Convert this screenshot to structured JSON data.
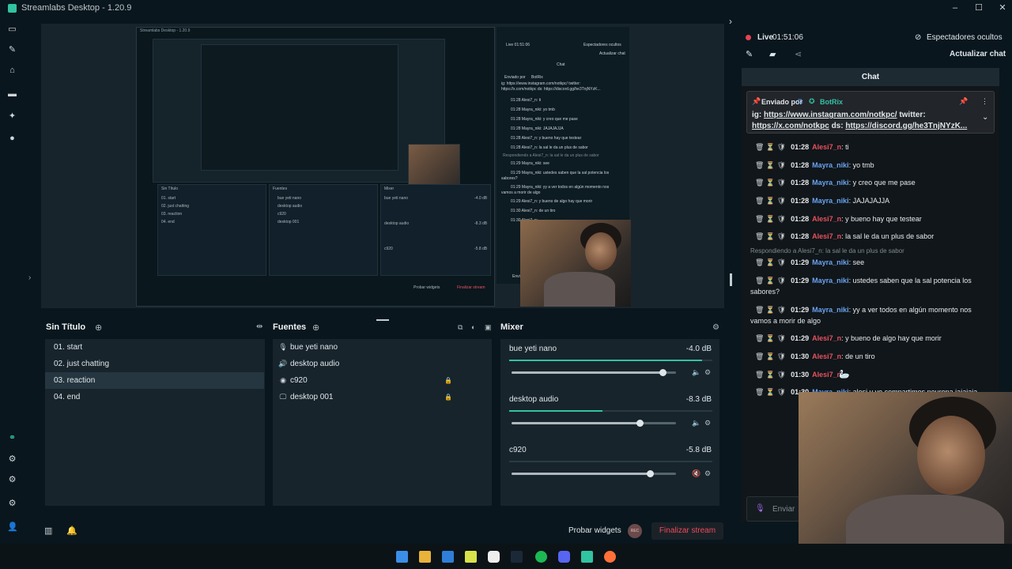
{
  "window": {
    "title": "Streamlabs Desktop - 1.20.9",
    "controls": [
      "–",
      "☐",
      "✕"
    ]
  },
  "inner_preview": {
    "title": "Streamlabs Desktop - 1.20.9",
    "scenes_title": "Sin Título",
    "scenes": [
      "01. start",
      "02. just chatting",
      "03. reaction",
      "04. end"
    ],
    "sources_title": "Fuentes",
    "sources": [
      "bue yeti nano",
      "desktop audio",
      "c920",
      "desktop 001"
    ],
    "mixer_title": "Mixer",
    "mixer": [
      {
        "name": "bue yeti nano",
        "db": "-4.0 dB"
      },
      {
        "name": "desktop audio",
        "db": "-8.3 dB"
      },
      {
        "name": "c920",
        "db": "-5.8 dB"
      }
    ],
    "probar": "Probar widgets",
    "finalizar": "Finalizar stream",
    "chat": {
      "live": "Live 01:51:06",
      "espectadores": "Espectadores ocultos",
      "actualizar": "Actualizar chat",
      "header": "Chat",
      "pinned_by": "Enviado por",
      "pinned_user": "BotRix",
      "pinned_text1": "ig: https://www.instagram.com/notkpc/ twitter:",
      "pinned_text2": "https://x.com/notkpc ds: https://discord.gg/he3TnjNYzK...",
      "lines": [
        "01:28 Alesi7_n: ti",
        "01:28 Mayra_niki: yo tmb",
        "01:28 Mayra_niki: y creo que me pase",
        "01:28 Mayra_niki: JAJAJAJJA",
        "01:28 Alesi7_n: y bueno hay que testear",
        "01:28 Alesi7_n: la sal le da un plus de sabor",
        "Respondiendo a Alesi7_n: la sal le da un plus de sabor",
        "01:29 Mayra_niki: see",
        "01:29 Mayra_niki: ustedes saben que la sal potencia los",
        "sabores?",
        "01:29 Mayra_niki: yy a ver todos en algún momento nos",
        "vamos a morir de algo",
        "01:29 Alesi7_n: y bueno de algo hay que morir",
        "01:30 Alesi7_n: de un tiro",
        "01:30 Alesi7_n:"
      ],
      "input": "Enviar"
    }
  },
  "scenes": {
    "title": "Sin Título",
    "items": [
      "01. start",
      "02. just chatting",
      "03. reaction",
      "04. end"
    ],
    "selected_index": 2
  },
  "sources": {
    "title": "Fuentes",
    "items": [
      {
        "label": "bue yeti nano",
        "icon": "mic-icon",
        "glyph": "🎙"
      },
      {
        "label": "desktop audio",
        "icon": "speaker-icon",
        "glyph": "🔊"
      },
      {
        "label": "c920",
        "icon": "webcam-icon",
        "glyph": "◉"
      },
      {
        "label": "desktop 001",
        "icon": "monitor-icon",
        "glyph": "🖵"
      }
    ]
  },
  "mixer": {
    "title": "Mixer",
    "channels": [
      {
        "name": "bue yeti nano",
        "db": "-4.0 dB",
        "level": 0.95,
        "volume": 0.92
      },
      {
        "name": "desktop audio",
        "db": "-8.3 dB",
        "level": 0.46,
        "volume": 0.78
      },
      {
        "name": "c920",
        "db": "-5.8 dB",
        "level": 0.0,
        "volume": 0.84
      }
    ]
  },
  "bottombar": {
    "probar": "Probar widgets",
    "rec": "REC",
    "finalizar": "Finalizar stream"
  },
  "chat": {
    "live_label": "Live",
    "live_time": "01:51:06",
    "espectadores": "Espectadores ocultos",
    "actualizar": "Actualizar chat",
    "header": "Chat",
    "pinned": {
      "by": "Enviado por",
      "user": "BotRix",
      "line1_prefix": "ig: ",
      "line1_link": "https://www.instagram.com/notkpc/",
      "line1_suffix": " twitter:",
      "line2_link1": "https://x.com/notkpc",
      "line2_mid": " ds: ",
      "line2_link2": "https://discord.gg/he3TnjNYzK..."
    },
    "messages": [
      {
        "time": "01:28",
        "user": "Alesi7_n",
        "color": "#e8515f",
        "text": ": ti"
      },
      {
        "time": "01:28",
        "user": "Mayra_niki",
        "color": "#6aa3f0",
        "text": ": yo tmb"
      },
      {
        "time": "01:28",
        "user": "Mayra_niki",
        "color": "#6aa3f0",
        "text": ": y creo que me pase"
      },
      {
        "time": "01:28",
        "user": "Mayra_niki",
        "color": "#6aa3f0",
        "text": ": JAJAJAJJA"
      },
      {
        "time": "01:28",
        "user": "Alesi7_n",
        "color": "#e8515f",
        "text": ": y bueno hay que testear"
      },
      {
        "time": "01:28",
        "user": "Alesi7_n",
        "color": "#e8515f",
        "text": ": la sal le da un plus de sabor"
      },
      {
        "time": "01:29",
        "user": "Mayra_niki",
        "color": "#6aa3f0",
        "text": ": see"
      },
      {
        "time": "01:29",
        "user": "Mayra_niki",
        "color": "#6aa3f0",
        "text": ": ustedes saben que la sal potencia los"
      },
      {
        "time": "01:29",
        "user": "Mayra_niki",
        "color": "#6aa3f0",
        "text": ": yy a ver todos en algún momento nos"
      },
      {
        "time": "01:29",
        "user": "Alesi7_n",
        "color": "#e8515f",
        "text": ": y bueno de algo hay que morir"
      },
      {
        "time": "01:30",
        "user": "Alesi7_n",
        "color": "#e8515f",
        "text": ": de un tiro"
      },
      {
        "time": "01:30",
        "user": "Alesi7_n",
        "color": "#e8515f",
        "text": ":"
      },
      {
        "time": "01:30",
        "user": "Mayra_niki",
        "color": "#6aa3f0",
        "text": ": alesi y yo compartimos neurona jajajaja"
      }
    ],
    "reply_note": "Respondiendo a Alesi7_n: la sal le da un plus de sabor",
    "wrap1": "sabores?",
    "wrap2": "vamos a morir de algo",
    "input_placeholder": "Enviar"
  },
  "colors": {
    "accent": "#31c3a2",
    "live": "#e84252",
    "alesi": "#e8515f",
    "mayra": "#6aa3f0"
  }
}
